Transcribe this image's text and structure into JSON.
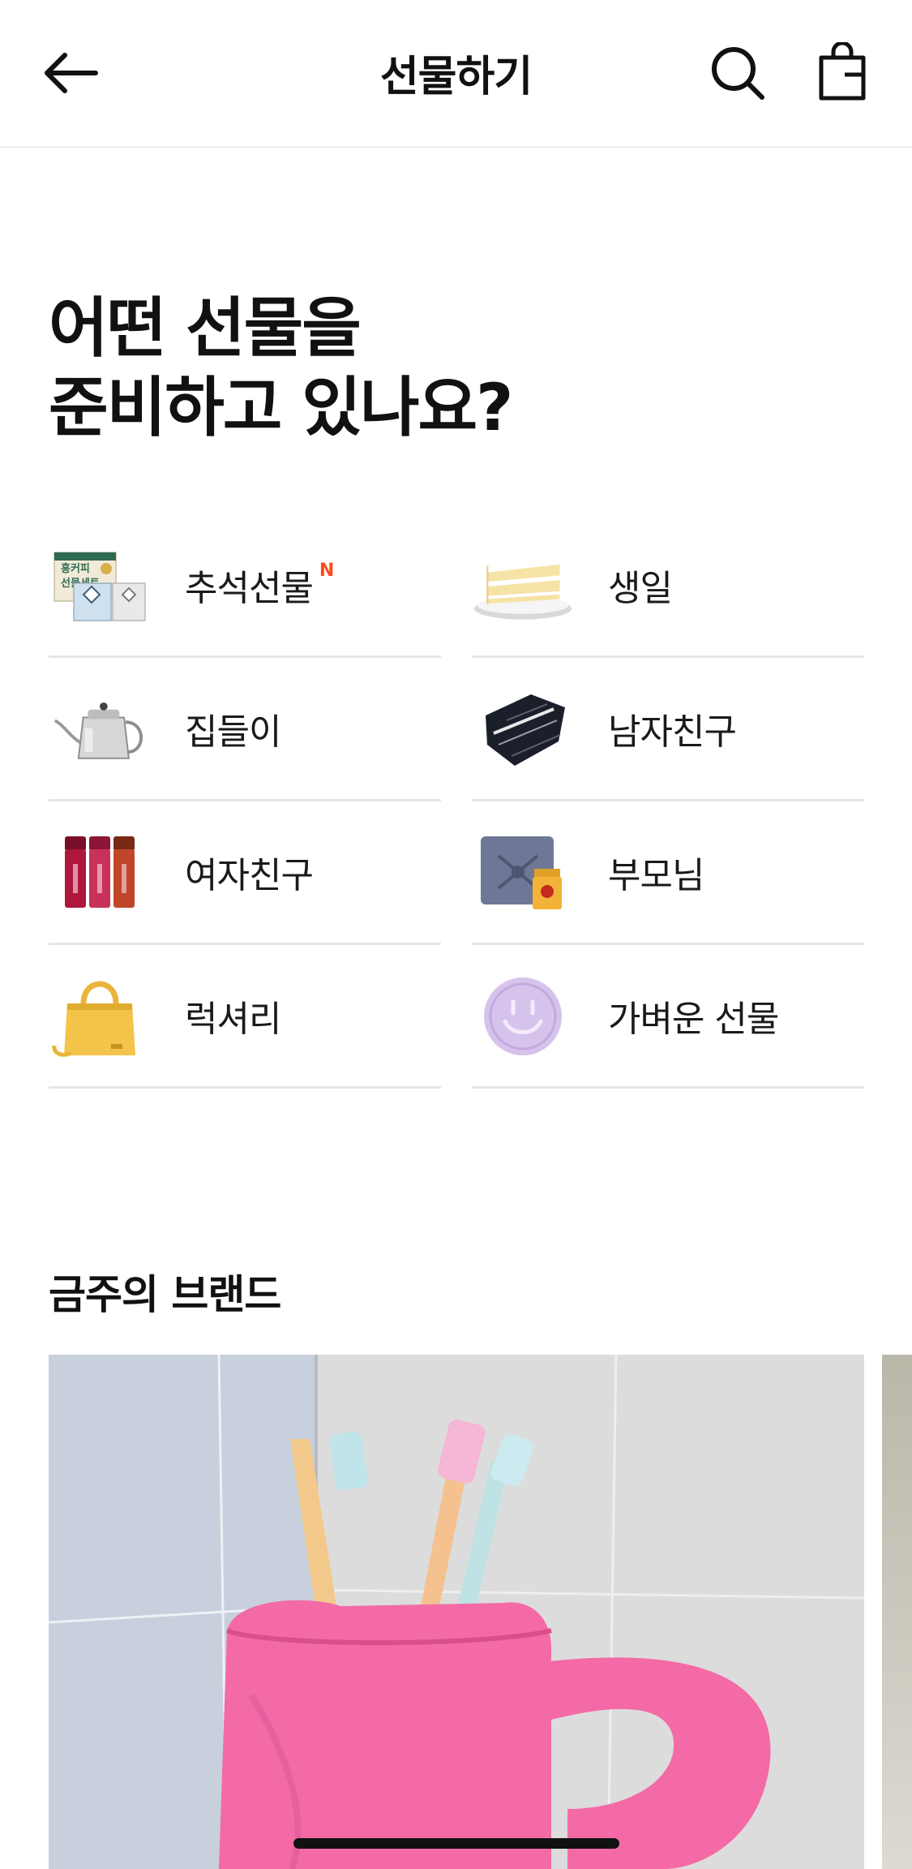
{
  "header": {
    "title": "선물하기"
  },
  "heading": {
    "line1": "어떤 선물을",
    "line2": "준비하고 있나요?"
  },
  "categories": [
    {
      "label": "추석선물",
      "badge": "N",
      "icon": "chuseok-gift-set-icon"
    },
    {
      "label": "생일",
      "icon": "cake-slice-icon"
    },
    {
      "label": "집들이",
      "icon": "kettle-icon"
    },
    {
      "label": "남자친구",
      "icon": "necktie-icon"
    },
    {
      "label": "여자친구",
      "icon": "lip-tint-icon"
    },
    {
      "label": "부모님",
      "icon": "wrapped-gift-honey-icon"
    },
    {
      "label": "럭셔리",
      "icon": "handbag-icon"
    },
    {
      "label": "가벼운 선물",
      "icon": "smiley-soap-icon"
    }
  ],
  "thumb_texts": {
    "chuseok_line1": "흥커피",
    "chuseok_line2": "선물세트"
  },
  "section": {
    "title": "금주의 브랜드"
  },
  "colors": {
    "accent_new": "#ff4a1c",
    "banner_pink": "#f36aa6",
    "divider": "#e6e6e6"
  }
}
